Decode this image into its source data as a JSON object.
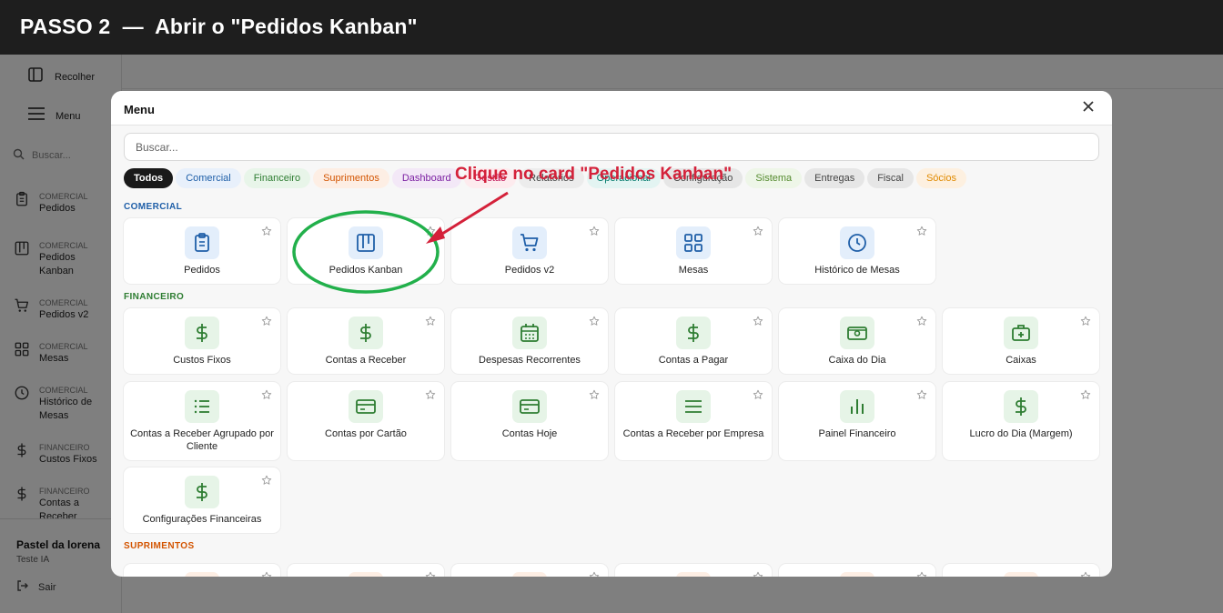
{
  "banner": {
    "title": "PASSO 2  —  Abrir o \"Pedidos Kanban\""
  },
  "sidebar": {
    "collapse_label": "Recolher",
    "menu_label": "Menu",
    "search_placeholder": "Buscar...",
    "items": [
      {
        "category": "COMERCIAL",
        "name": "Pedidos",
        "icon": "clipboard-icon"
      },
      {
        "category": "COMERCIAL",
        "name": "Pedidos Kanban",
        "icon": "kanban-icon"
      },
      {
        "category": "COMERCIAL",
        "name": "Pedidos v2",
        "icon": "cart-icon"
      },
      {
        "category": "COMERCIAL",
        "name": "Mesas",
        "icon": "grid-icon"
      },
      {
        "category": "COMERCIAL",
        "name": "Histórico de Mesas",
        "icon": "clock-icon"
      },
      {
        "category": "FINANCEIRO",
        "name": "Custos Fixos",
        "icon": "dollar-icon"
      },
      {
        "category": "FINANCEIRO",
        "name": "Contas a Receber",
        "icon": "dollar-icon"
      }
    ],
    "user_name": "Pastel da lorena",
    "user_sub": "Teste IA",
    "logout_label": "Sair"
  },
  "modal": {
    "title": "Menu",
    "search_placeholder": "Buscar...",
    "chips": [
      {
        "label": "Todos",
        "bg": "#1a1a1a",
        "fg": "#ffffff"
      },
      {
        "label": "Comercial",
        "bg": "#e8f0fb",
        "fg": "#1f5fa8"
      },
      {
        "label": "Financeiro",
        "bg": "#e8f5e9",
        "fg": "#2e7d32"
      },
      {
        "label": "Suprimentos",
        "bg": "#fdeee4",
        "fg": "#d35400"
      },
      {
        "label": "Dashboard",
        "bg": "#f3e8f7",
        "fg": "#7b1fa2"
      },
      {
        "label": "Gestão",
        "bg": "#fdebee",
        "fg": "#c2185b"
      },
      {
        "label": "Relatórios",
        "bg": "#ececec",
        "fg": "#444444"
      },
      {
        "label": "Operacional",
        "bg": "#e3f4f2",
        "fg": "#00796b"
      },
      {
        "label": "Configuração",
        "bg": "#e6e6e6",
        "fg": "#444444"
      },
      {
        "label": "Sistema",
        "bg": "#eef6e8",
        "fg": "#558b2f"
      },
      {
        "label": "Entregas",
        "bg": "#e6e6e6",
        "fg": "#444444"
      },
      {
        "label": "Fiscal",
        "bg": "#e6e6e6",
        "fg": "#444444"
      },
      {
        "label": "Sócios",
        "bg": "#fdf0e0",
        "fg": "#e08a00"
      }
    ],
    "sections": [
      {
        "label": "COMERCIAL",
        "color": "#1f5fa8",
        "icon_bg": "#e3eefb",
        "icon_fg": "#1f5fa8",
        "cards": [
          {
            "label": "Pedidos",
            "icon": "clipboard-icon"
          },
          {
            "label": "Pedidos Kanban",
            "icon": "kanban-icon"
          },
          {
            "label": "Pedidos v2",
            "icon": "cart-icon"
          },
          {
            "label": "Mesas",
            "icon": "grid-icon"
          },
          {
            "label": "Histórico de Mesas",
            "icon": "clock-icon"
          }
        ]
      },
      {
        "label": "FINANCEIRO",
        "color": "#2e7d32",
        "icon_bg": "#e6f4e7",
        "icon_fg": "#2e7d32",
        "cards": [
          {
            "label": "Custos Fixos",
            "icon": "dollar-icon"
          },
          {
            "label": "Contas a Receber",
            "icon": "dollar-icon"
          },
          {
            "label": "Despesas Recorrentes",
            "icon": "calendar-icon"
          },
          {
            "label": "Contas a Pagar",
            "icon": "dollar-icon"
          },
          {
            "label": "Caixa do Dia",
            "icon": "cash-icon"
          },
          {
            "label": "Caixas",
            "icon": "briefcase-icon"
          },
          {
            "label": "Contas a Receber Agrupado por Cliente",
            "icon": "list-icon"
          },
          {
            "label": "Contas por Cartão",
            "icon": "credit-card-icon"
          },
          {
            "label": "Contas Hoje",
            "icon": "credit-card-icon"
          },
          {
            "label": "Contas a Receber por Empresa",
            "icon": "lines-icon"
          },
          {
            "label": "Painel Financeiro",
            "icon": "bar-chart-icon"
          },
          {
            "label": "Lucro do Dia (Margem)",
            "icon": "dollar-icon"
          },
          {
            "label": "Configurações Financeiras",
            "icon": "dollar-icon"
          }
        ]
      },
      {
        "label": "SUPRIMENTOS",
        "color": "#d35400",
        "icon_bg": "#fdeee4",
        "icon_fg": "#e67e22",
        "cards": [
          {
            "label": "",
            "icon": "supply-icon"
          },
          {
            "label": "",
            "icon": "supply-icon"
          },
          {
            "label": "",
            "icon": "supply-icon"
          },
          {
            "label": "",
            "icon": "supply-icon"
          },
          {
            "label": "",
            "icon": "home-icon"
          },
          {
            "label": "",
            "icon": "supply-icon"
          }
        ]
      }
    ]
  },
  "annotation": {
    "text": "Clique no card \"Pedidos Kanban\"",
    "color": "#d4213a",
    "highlight_color": "#22b04b"
  }
}
